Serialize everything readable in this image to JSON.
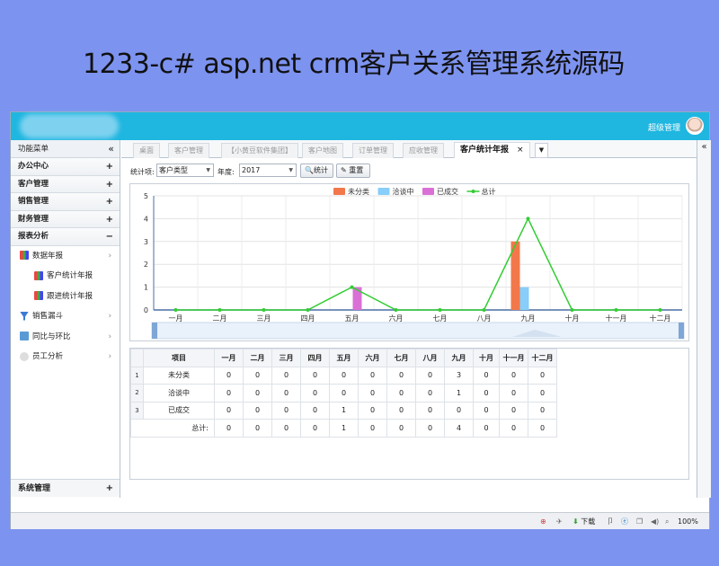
{
  "banner": "1233-c# asp.net crm客户关系管理系统源码",
  "topbar": {
    "user": "超级管理"
  },
  "sidebar": {
    "header": "功能菜单",
    "collapse": "«",
    "groups": [
      {
        "label": "办公中心",
        "toggle": "+"
      },
      {
        "label": "客户管理",
        "toggle": "+"
      },
      {
        "label": "销售管理",
        "toggle": "+"
      },
      {
        "label": "财务管理",
        "toggle": "+"
      },
      {
        "label": "报表分析",
        "toggle": "−"
      }
    ],
    "items": [
      {
        "label": "数据年报",
        "arrow": "›"
      },
      {
        "label": "客户统计年报"
      },
      {
        "label": "跟进统计年报"
      },
      {
        "label": "销售漏斗",
        "arrow": "›"
      },
      {
        "label": "同比与环比",
        "arrow": "›"
      },
      {
        "label": "员工分析",
        "arrow": "›"
      }
    ],
    "bottom": {
      "label": "系统管理",
      "toggle": "+"
    }
  },
  "tabs": [
    {
      "label": "桌面"
    },
    {
      "label": "客户管理"
    },
    {
      "label": "【小黄豆软件集团】"
    },
    {
      "label": "客户地图"
    },
    {
      "label": "订单管理"
    },
    {
      "label": "应收管理"
    },
    {
      "label": "客户统计年报",
      "close": "×"
    }
  ],
  "tab_dropdown": "▼",
  "right_collapse": "«",
  "toolbar": {
    "type_label": "统计项:",
    "type_value": "客户类型",
    "year_label": "年度:",
    "year_value": "2017",
    "stat_btn": "统计",
    "reset_btn": "重置"
  },
  "chart_data": {
    "type": "bar",
    "categories": [
      "一月",
      "二月",
      "三月",
      "四月",
      "五月",
      "六月",
      "七月",
      "八月",
      "九月",
      "十月",
      "十一月",
      "十二月"
    ],
    "series": [
      {
        "name": "未分类",
        "type": "bar",
        "color": "#f2784b",
        "values": [
          0,
          0,
          0,
          0,
          0,
          0,
          0,
          0,
          3,
          0,
          0,
          0
        ]
      },
      {
        "name": "洽谈中",
        "type": "bar",
        "color": "#87cefa",
        "values": [
          0,
          0,
          0,
          0,
          0,
          0,
          0,
          0,
          1,
          0,
          0,
          0
        ]
      },
      {
        "name": "已成交",
        "type": "bar",
        "color": "#da70d6",
        "values": [
          0,
          0,
          0,
          0,
          1,
          0,
          0,
          0,
          0,
          0,
          0,
          0
        ]
      },
      {
        "name": "总计",
        "type": "line",
        "color": "#32cd32",
        "values": [
          0,
          0,
          0,
          0,
          1,
          0,
          0,
          0,
          4,
          0,
          0,
          0
        ]
      }
    ],
    "yticks": [
      "0",
      "1",
      "2",
      "3",
      "4",
      "5"
    ],
    "ylim": [
      0,
      5
    ],
    "legend": "top-center",
    "grid": true
  },
  "table": {
    "headers": [
      "项目",
      "一月",
      "二月",
      "三月",
      "四月",
      "五月",
      "六月",
      "七月",
      "八月",
      "九月",
      "十月",
      "十一月",
      "十二月"
    ],
    "rows": [
      {
        "n": "1",
        "cells": [
          "未分类",
          "0",
          "0",
          "0",
          "0",
          "0",
          "0",
          "0",
          "0",
          "3",
          "0",
          "0",
          "0"
        ]
      },
      {
        "n": "2",
        "cells": [
          "洽谈中",
          "0",
          "0",
          "0",
          "0",
          "0",
          "0",
          "0",
          "0",
          "1",
          "0",
          "0",
          "0"
        ]
      },
      {
        "n": "3",
        "cells": [
          "已成交",
          "0",
          "0",
          "0",
          "0",
          "1",
          "0",
          "0",
          "0",
          "0",
          "0",
          "0",
          "0"
        ]
      }
    ],
    "total": [
      "总计:",
      "0",
      "0",
      "0",
      "0",
      "1",
      "0",
      "0",
      "0",
      "4",
      "0",
      "0",
      "0"
    ]
  },
  "status": {
    "download": "下载",
    "zoom": "100%"
  }
}
